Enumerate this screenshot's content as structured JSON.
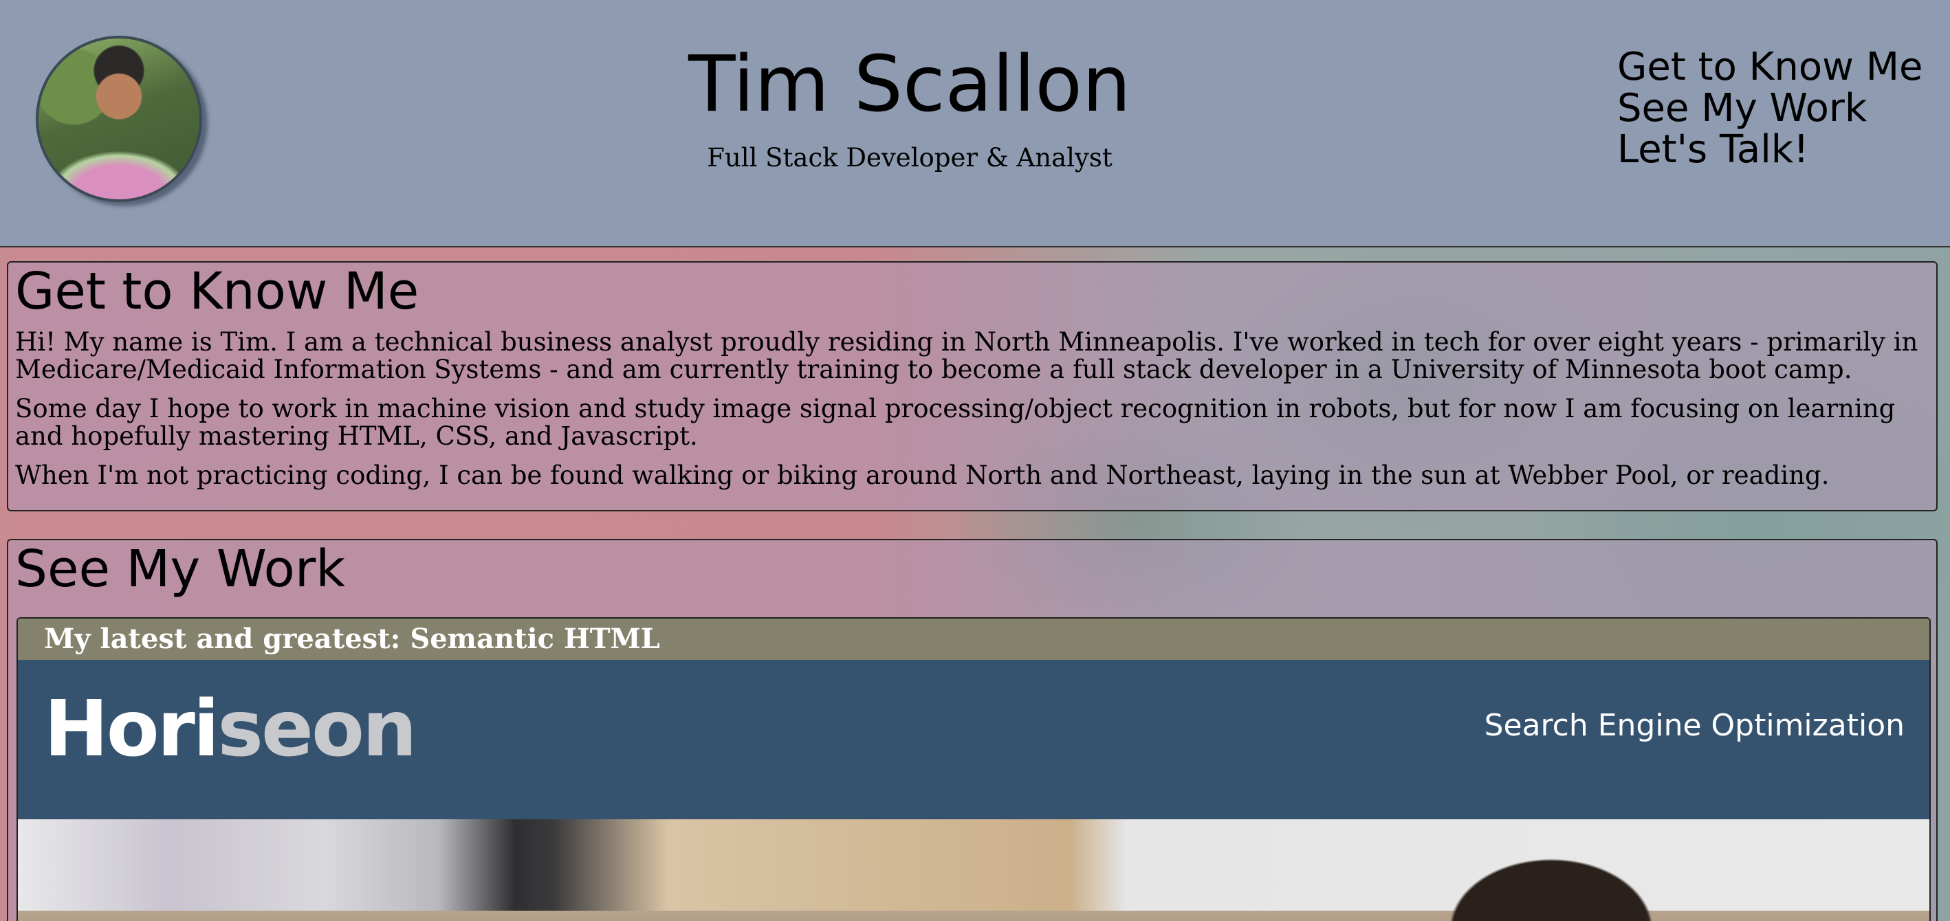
{
  "header": {
    "name": "Tim Scallon",
    "subtitle": "Full Stack Developer & Analyst",
    "nav": [
      {
        "label": "Get to Know Me"
      },
      {
        "label": "See My Work"
      },
      {
        "label": "Let's Talk!"
      }
    ]
  },
  "about": {
    "heading": "Get to Know Me",
    "paragraphs": [
      "Hi! My name is Tim. I am a technical business analyst proudly residing in North Minneapolis. I've worked in tech for over eight years - primarily in Medicare/Medicaid Information Systems - and am currently training to become a full stack developer in a University of Minnesota boot camp.",
      "Some day I hope to work in machine vision and study image signal processing/object recognition in robots, but for now I am focusing on learning and hopefully mastering HTML, CSS, and Javascript.",
      "When I'm not practicing coding, I can be found walking or biking around North and Northeast, laying in the sun at Webber Pool, or reading."
    ]
  },
  "work": {
    "heading": "See My Work",
    "featured": {
      "caption": "My latest and greatest: Semantic HTML",
      "logo_main": "Hori",
      "logo_light": "seon",
      "tagline": "Search Engine Optimization"
    }
  },
  "colors": {
    "header_bg": "#8e9bb1",
    "caption_bg": "#84826c",
    "horiseon_bar": "#35536f"
  }
}
